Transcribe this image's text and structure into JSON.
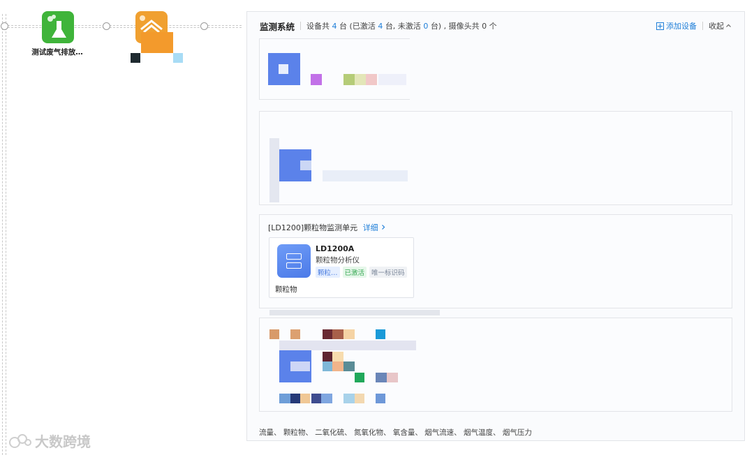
{
  "canvas": {
    "node1_label": "测试废气排放…"
  },
  "watermark": {
    "text": "大数跨境"
  },
  "panel": {
    "title": "监测系统",
    "summary_prefix": "设备共",
    "device_total": "4",
    "summary_mid1": "台  (已激活",
    "activated": "4",
    "summary_mid2": "台, 未激活",
    "inactive": "0",
    "summary_mid3": "台)  , 摄像头共",
    "camera_total": "0",
    "summary_suffix": "个",
    "add_device": "添加设备",
    "collapse": "收起"
  },
  "group3": {
    "title": "[LD1200]颗粒物监测单元",
    "detail": "详细",
    "device": {
      "model": "LD1200A",
      "type": "颗粒物分析仪",
      "tag1": "颗粒…",
      "tag2": "已激活",
      "tag3": "唯一标识码",
      "param": "颗粒物"
    }
  },
  "footer": {
    "params": "流量、 颗粒物、 二氧化硫、 氮氧化物、 氧含量、 烟气流速、 烟气温度、 烟气压力"
  },
  "colors": {
    "accent": "#1e7ed8",
    "node_green": "#3fb43a",
    "node_orange": "#f0a030",
    "device_icon": "#5b88ee",
    "active_green": "#3aaa56"
  }
}
